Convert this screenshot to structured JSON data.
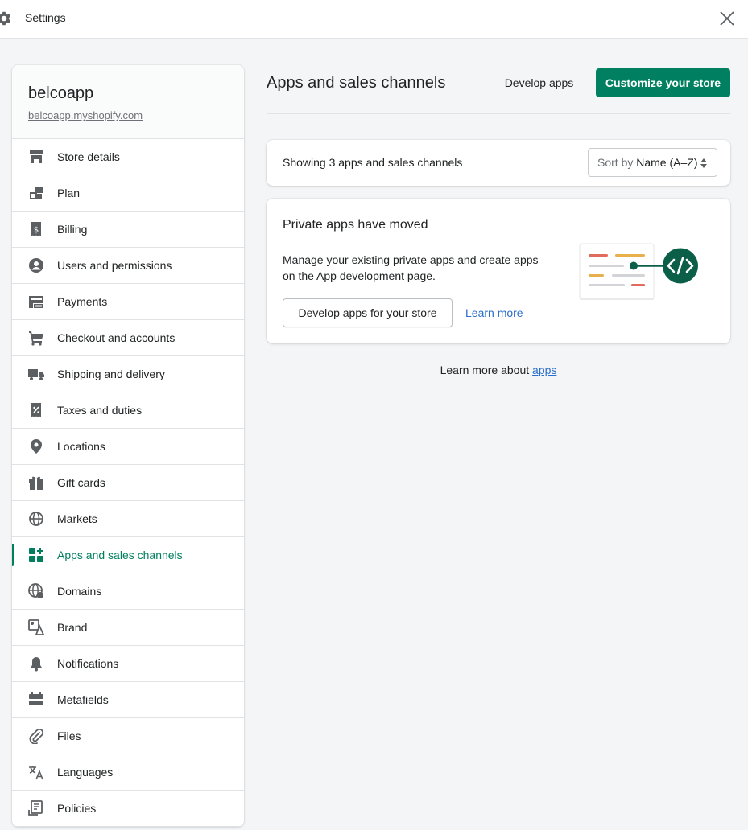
{
  "topbar": {
    "title": "Settings",
    "icon": "gear-icon",
    "close_icon": "close-icon"
  },
  "store": {
    "name": "belcoapp",
    "url": "belcoapp.myshopify.com"
  },
  "sidebar": {
    "items": [
      {
        "label": "Store details",
        "icon": "store-icon"
      },
      {
        "label": "Plan",
        "icon": "plan-icon"
      },
      {
        "label": "Billing",
        "icon": "billing-icon"
      },
      {
        "label": "Users and permissions",
        "icon": "user-icon"
      },
      {
        "label": "Payments",
        "icon": "payments-icon"
      },
      {
        "label": "Checkout and accounts",
        "icon": "cart-icon"
      },
      {
        "label": "Shipping and delivery",
        "icon": "truck-icon"
      },
      {
        "label": "Taxes and duties",
        "icon": "tax-icon"
      },
      {
        "label": "Locations",
        "icon": "location-icon"
      },
      {
        "label": "Gift cards",
        "icon": "gift-icon"
      },
      {
        "label": "Markets",
        "icon": "globe-icon"
      },
      {
        "label": "Apps and sales channels",
        "icon": "apps-icon",
        "active": true
      },
      {
        "label": "Domains",
        "icon": "domains-icon"
      },
      {
        "label": "Brand",
        "icon": "brand-icon"
      },
      {
        "label": "Notifications",
        "icon": "bell-icon"
      },
      {
        "label": "Metafields",
        "icon": "metafields-icon"
      },
      {
        "label": "Files",
        "icon": "paperclip-icon"
      },
      {
        "label": "Languages",
        "icon": "translate-icon"
      },
      {
        "label": "Policies",
        "icon": "policies-icon"
      }
    ]
  },
  "main": {
    "title": "Apps and sales channels",
    "develop_apps": "Develop apps",
    "customize_store": "Customize your store",
    "list": {
      "count_text": "Showing 3 apps and sales channels",
      "sort_prefix": "Sort by",
      "sort_value": "Name (A–Z)"
    },
    "moved_card": {
      "heading": "Private apps have moved",
      "body": "Manage your existing private apps and create apps on the App development page.",
      "button": "Develop apps for your store",
      "learn_more": "Learn more"
    },
    "footer_prefix": "Learn more about",
    "footer_link": "apps"
  },
  "colors": {
    "accent": "#008060",
    "active_nav": "#007f5f",
    "link": "#2c6ecb",
    "icon": "#5c5f62"
  }
}
